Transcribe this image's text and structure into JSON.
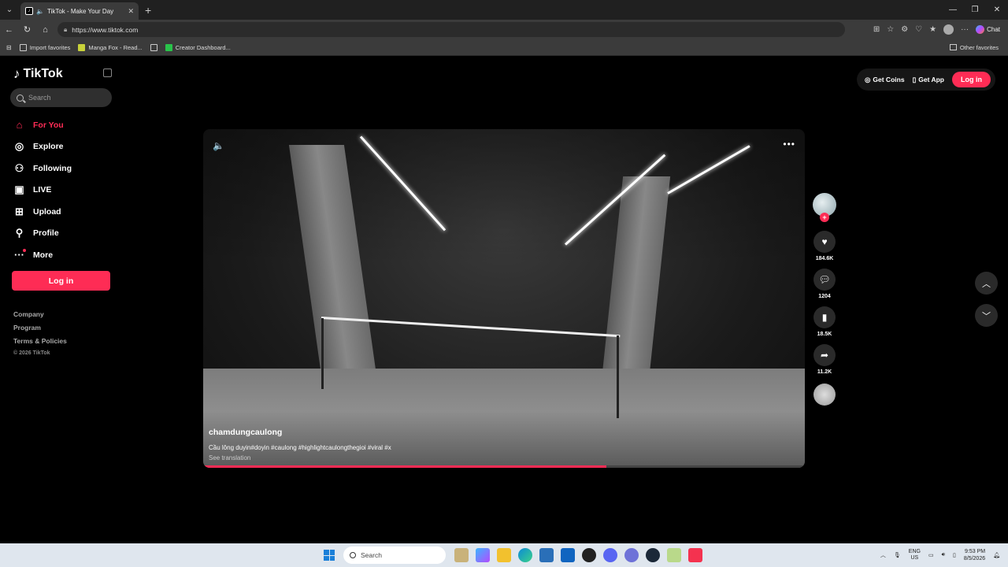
{
  "browser": {
    "tab_title": "TikTok - Make Your Day",
    "url": "https://www.tiktok.com",
    "chat_label": "Chat",
    "bookmarks": [
      "Import favorites",
      "Manga Fox - Read...",
      "Creator Dashboard..."
    ],
    "other_favorites": "Other favorites"
  },
  "sidebar": {
    "brand": "TikTok",
    "search_placeholder": "Search",
    "nav": [
      {
        "label": "For You",
        "icon": "home-icon"
      },
      {
        "label": "Explore",
        "icon": "compass-icon"
      },
      {
        "label": "Following",
        "icon": "user-plus-icon"
      },
      {
        "label": "LIVE",
        "icon": "live-icon"
      },
      {
        "label": "Upload",
        "icon": "plus-square-icon"
      },
      {
        "label": "Profile",
        "icon": "person-icon"
      },
      {
        "label": "More",
        "icon": "more-dots-icon"
      }
    ],
    "login_label": "Log in",
    "footer": [
      "Company",
      "Program",
      "Terms & Policies",
      "© 2026 TikTok"
    ]
  },
  "topbar": {
    "get_coins": "Get Coins",
    "get_app": "Get App",
    "login": "Log in"
  },
  "video": {
    "username": "chamdungcaulong",
    "description": "Cầu lông duyin#doyin #caulong #highlightcaulongthegioi #viral #x",
    "see_translation": "See translation",
    "progress": 0.67
  },
  "actions": {
    "likes": "184.6K",
    "comments": "1204",
    "saves": "18.5K",
    "shares": "11.2K"
  },
  "taskbar": {
    "search": "Search",
    "lang_line1": "ENG",
    "lang_line2": "US",
    "time": "9:53 PM",
    "date": "8/5/2026"
  }
}
